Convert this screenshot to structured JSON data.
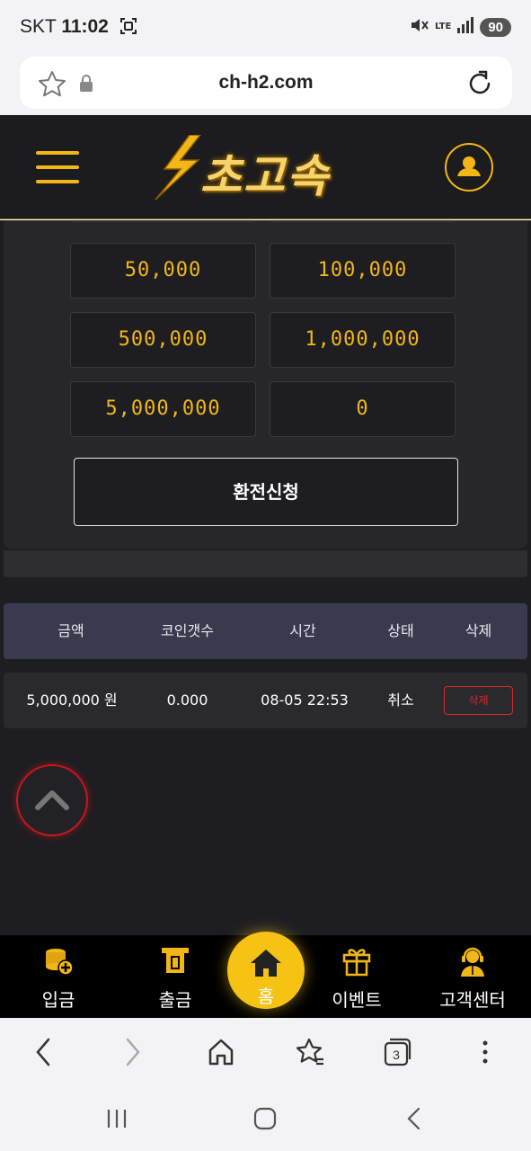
{
  "status_bar": {
    "carrier": "SKT",
    "time": "11:02",
    "network": "LTE",
    "battery": "90"
  },
  "browser": {
    "url": "ch-h2.com",
    "tab_count": "3"
  },
  "header": {
    "logo_text": "초고속"
  },
  "amounts": {
    "a1": "50,000",
    "a2": "100,000",
    "a3": "500,000",
    "a4": "1,000,000",
    "a5": "5,000,000",
    "a6": "0"
  },
  "exchange_button": "환전신청",
  "table": {
    "headers": [
      "금액",
      "코인갯수",
      "시간",
      "상태",
      "삭제"
    ],
    "rows": [
      {
        "amount": "5,000,000 원",
        "coins": "0.000",
        "time": "08-05 22:53",
        "status": "취소",
        "delete": "삭제"
      }
    ]
  },
  "bottom_nav": {
    "deposit": "입금",
    "withdraw": "출금",
    "home": "홈",
    "event": "이벤트",
    "support": "고객센터"
  },
  "colors": {
    "accent": "#f2b716",
    "danger": "#d42a2a",
    "background": "#1e1e22"
  }
}
